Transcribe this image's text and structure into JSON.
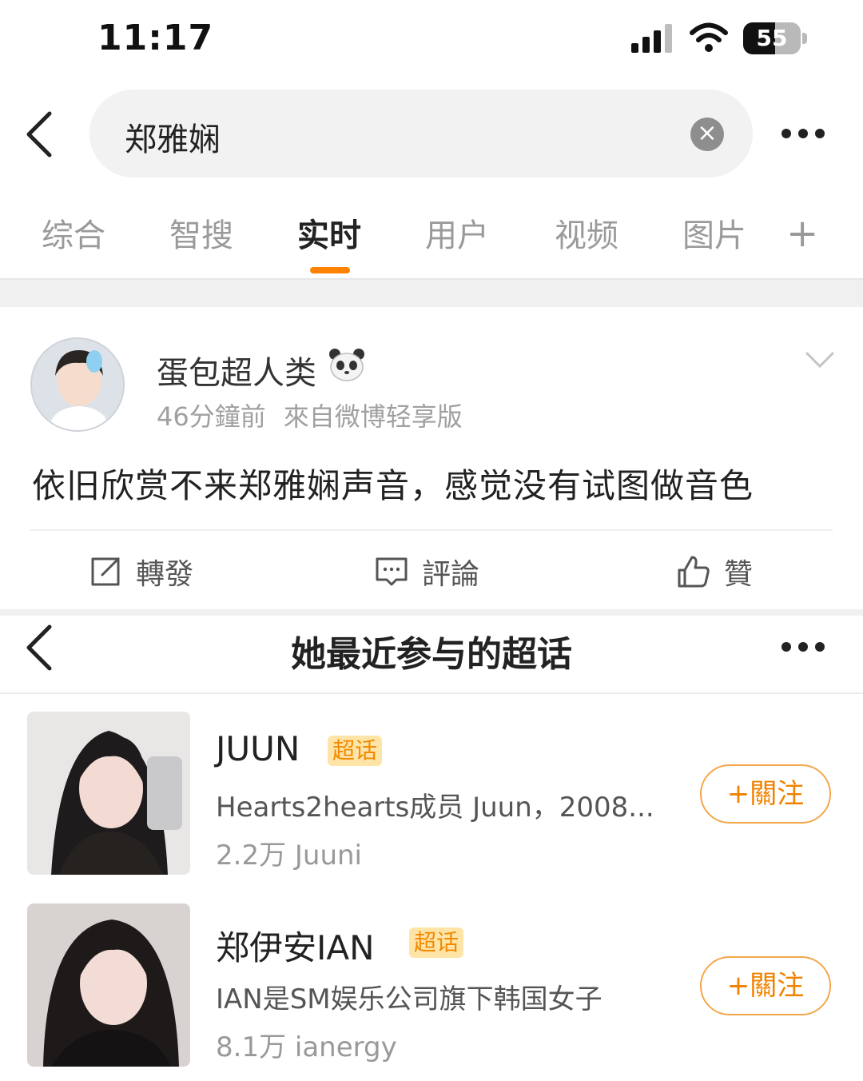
{
  "status_bar": {
    "time": "11:17",
    "battery": "55",
    "battery_level": 0.55
  },
  "search": {
    "query": "郑雅娴",
    "clear_glyph": "×"
  },
  "tabs": [
    {
      "label": "综合",
      "active": false
    },
    {
      "label": "智搜",
      "active": false
    },
    {
      "label": "实时",
      "active": true
    },
    {
      "label": "用户",
      "active": false
    },
    {
      "label": "视频",
      "active": false
    },
    {
      "label": "图片",
      "active": false
    }
  ],
  "tab_add": "+",
  "post": {
    "username": "蛋包超人类",
    "time_ago": "46分鐘前",
    "source": "來自微博轻享版",
    "text": "依旧欣赏不来郑雅娴声音，感觉没有试图做音色",
    "actions": {
      "repost": "轉發",
      "comment": "評論",
      "like": "贊"
    }
  },
  "supertopics_panel": {
    "title": "她最近参与的超话",
    "topics": [
      {
        "name": "JUUN",
        "badge": "超话",
        "description": "Hearts2hearts成员 Juun，2008...",
        "stats": "2.2万 Juuni",
        "follow_label": "+關注"
      },
      {
        "name": "郑伊安IAN",
        "badge": "超话",
        "description": "IAN是SM娱乐公司旗下韩国女子",
        "stats": "8.1万 ianergy",
        "follow_label": "+關注"
      }
    ]
  },
  "colors": {
    "accent": "#ff8200",
    "badge_bg": "#ffe4a8",
    "badge_text": "#f08a00",
    "muted": "#9a9a9a"
  }
}
